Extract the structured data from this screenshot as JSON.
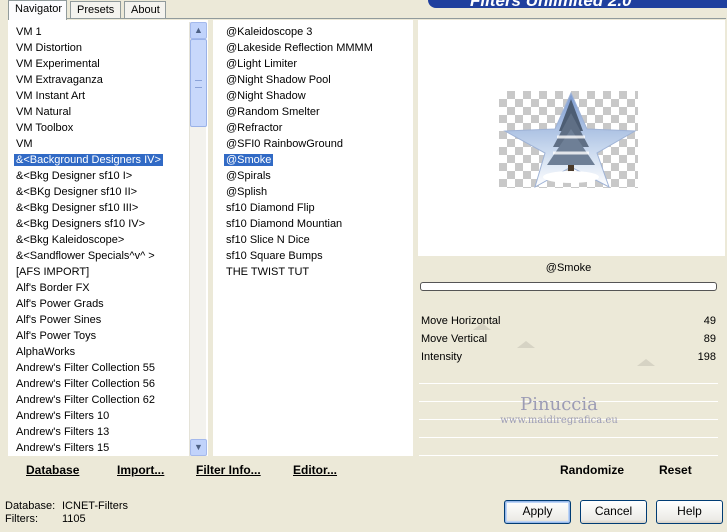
{
  "tabs": [
    {
      "label": "Navigator",
      "active": true
    },
    {
      "label": "Presets",
      "active": false
    },
    {
      "label": "About",
      "active": false
    }
  ],
  "title_banner": "Filters Unlimited 2.0",
  "categories": [
    "VM 1",
    "VM Distortion",
    "VM Experimental",
    "VM Extravaganza",
    "VM Instant Art",
    "VM Natural",
    "VM Toolbox",
    "VM",
    "&<Background Designers IV>",
    "&<Bkg Designer sf10 I>",
    "&<BKg Designer sf10 II>",
    "&<Bkg Designer sf10 III>",
    "&<Bkg Designers sf10 IV>",
    "&<Bkg Kaleidoscope>",
    "&<Sandflower Specials^v^ >",
    "[AFS IMPORT]",
    "Alf's Border FX",
    "Alf's Power Grads",
    "Alf's Power Sines",
    "Alf's Power Toys",
    "AlphaWorks",
    "Andrew's Filter Collection 55",
    "Andrew's Filter Collection 56",
    "Andrew's Filter Collection 62",
    "Andrew's Filters 10",
    "Andrew's Filters 13",
    "Andrew's Filters 15"
  ],
  "selected_category": "&<Background Designers IV>",
  "filters": [
    "@Kaleidoscope 3",
    "@Lakeside Reflection MMMM",
    "@Light Limiter",
    "@Night Shadow Pool",
    "@Night Shadow",
    "@Random Smelter",
    "@Refractor",
    "@SFI0 RainbowGround",
    "@Smoke",
    "@Spirals",
    "@Splish",
    "sf10 Diamond Flip",
    "sf10 Diamond Mountian",
    "sf10 Slice N Dice",
    "sf10 Square Bumps",
    "THE TWIST TUT"
  ],
  "selected_filter": "@Smoke",
  "filter_name": "@Smoke",
  "sliders": [
    {
      "label": "Move Horizontal",
      "value": "49",
      "level": 49
    },
    {
      "label": "Move Vertical",
      "value": "89",
      "level": 89
    },
    {
      "label": "Intensity",
      "value": "198",
      "level": 198
    }
  ],
  "watermark": {
    "line1": "Pinuccia",
    "line2": "www.maidiregrafica.eu"
  },
  "left_buttons": {
    "database": "Database",
    "import": "Import...",
    "filter_info": "Filter Info...",
    "editor": "Editor..."
  },
  "right_buttons": {
    "randomize": "Randomize",
    "reset": "Reset"
  },
  "status": {
    "database_label": "Database:",
    "database_value": "ICNET-Filters",
    "filters_label": "Filters:",
    "filters_value": "1105"
  },
  "dialog_buttons": {
    "apply": "Apply",
    "cancel": "Cancel",
    "help": "Help"
  },
  "colors": {
    "selection": "#316ac5",
    "dialog_bg": "#ece9d8",
    "banner": "#1f3f9e"
  }
}
